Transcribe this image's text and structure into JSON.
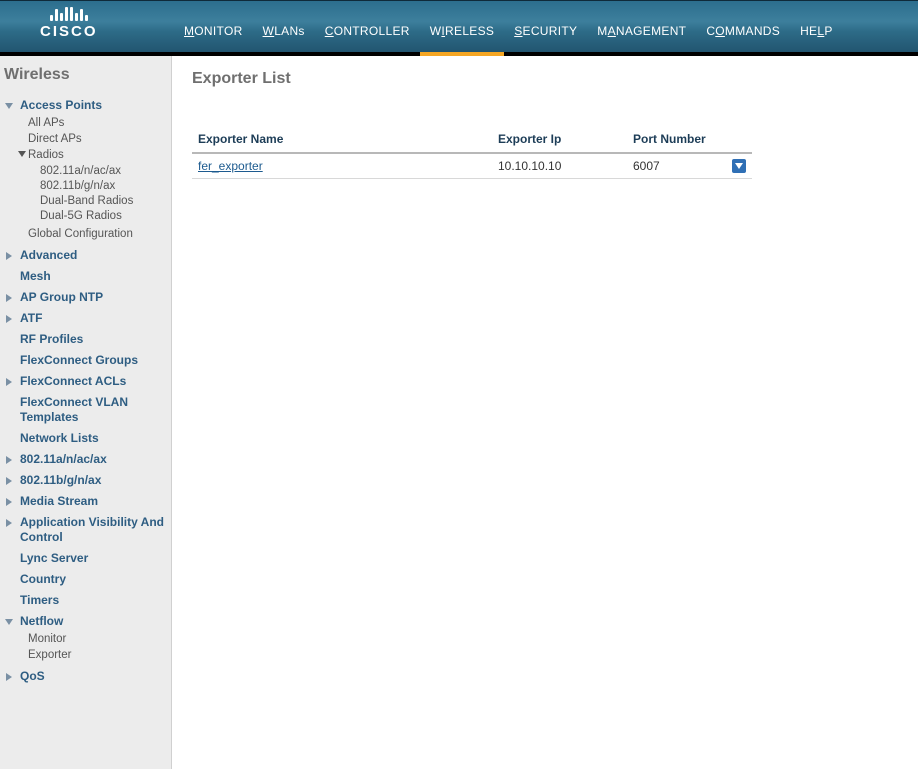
{
  "brand": "CISCO",
  "topnav": [
    {
      "label": "MONITOR",
      "u": "M"
    },
    {
      "label": "WLANs",
      "u": "W"
    },
    {
      "label": "CONTROLLER",
      "u": "C"
    },
    {
      "label": "WIRELESS",
      "u": "I",
      "active": true
    },
    {
      "label": "SECURITY",
      "u": "S"
    },
    {
      "label": "MANAGEMENT",
      "u": "A"
    },
    {
      "label": "COMMANDS",
      "u": "O"
    },
    {
      "label": "HELP",
      "u": "L"
    }
  ],
  "sidebar": {
    "title": "Wireless",
    "items": [
      {
        "label": "Access Points",
        "expanded": true,
        "children": [
          {
            "label": "All APs"
          },
          {
            "label": "Direct APs"
          },
          {
            "label": "Radios",
            "expanded": true,
            "children2": [
              {
                "label": "802.11a/n/ac/ax"
              },
              {
                "label": "802.11b/g/n/ax"
              },
              {
                "label": "Dual-Band Radios"
              },
              {
                "label": "Dual-5G Radios"
              }
            ]
          },
          {
            "label": "Global Configuration"
          }
        ]
      },
      {
        "label": "Advanced",
        "arrow": true
      },
      {
        "label": "Mesh"
      },
      {
        "label": "AP Group NTP",
        "arrow": true
      },
      {
        "label": "ATF",
        "arrow": true
      },
      {
        "label": "RF Profiles"
      },
      {
        "label": "FlexConnect Groups"
      },
      {
        "label": "FlexConnect ACLs",
        "arrow": true
      },
      {
        "label": "FlexConnect VLAN Templates"
      },
      {
        "label": "Network Lists"
      },
      {
        "label": "802.11a/n/ac/ax",
        "arrow": true
      },
      {
        "label": "802.11b/g/n/ax",
        "arrow": true
      },
      {
        "label": "Media Stream",
        "arrow": true
      },
      {
        "label": "Application Visibility And Control",
        "arrow": true
      },
      {
        "label": "Lync Server"
      },
      {
        "label": "Country"
      },
      {
        "label": "Timers"
      },
      {
        "label": "Netflow",
        "expanded": true,
        "children": [
          {
            "label": "Monitor"
          },
          {
            "label": "Exporter"
          }
        ]
      },
      {
        "label": "QoS",
        "arrow": true
      }
    ]
  },
  "content": {
    "title": "Exporter List",
    "columns": [
      "Exporter Name",
      "Exporter Ip",
      "Port Number"
    ],
    "rows": [
      {
        "name": "fer_exporter",
        "ip": "10.10.10.10",
        "port": "6007"
      }
    ]
  }
}
